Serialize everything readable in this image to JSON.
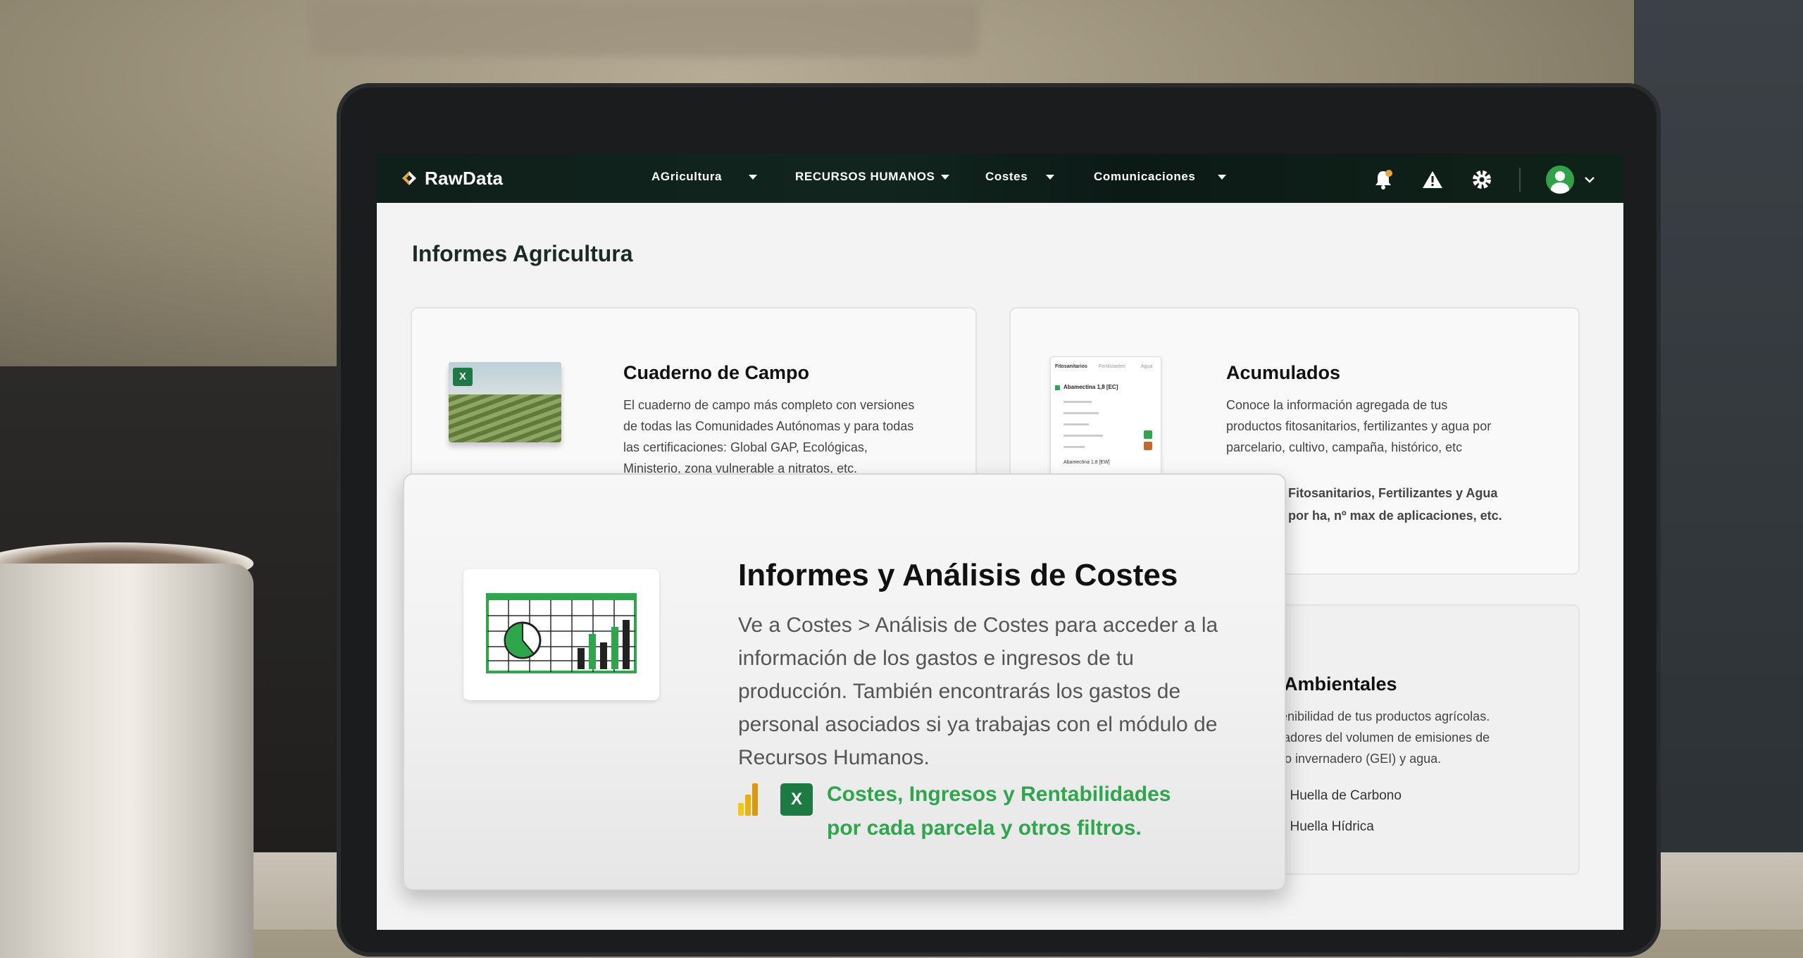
{
  "nav": {
    "brand": "RawData",
    "menus": [
      {
        "label": "AGricultura"
      },
      {
        "label": "RECURSOS HUMANOS"
      },
      {
        "label": "Costes"
      },
      {
        "label": "Comunicaciones"
      }
    ],
    "icons": [
      "bell-icon",
      "warning-icon",
      "gear-icon",
      "user-avatar",
      "chevron-down-icon"
    ],
    "accent": "#2ea64b"
  },
  "page": {
    "title": "Informes Agricultura"
  },
  "cards": {
    "cuaderno": {
      "title": "Cuaderno de Campo",
      "desc": [
        "El cuaderno de campo más completo con versiones",
        "de todas las Comunidades Autónomas y para todas",
        "las certificaciones: Global GAP, Ecológicas,",
        "Ministerio, zona vulnerable a nitratos, etc."
      ]
    },
    "acumulados": {
      "title": "Acumulados",
      "desc": [
        "Conoce la información agregada de tus",
        "productos fitosanitarios, fertilizantes y agua por",
        "parcelario, cultivo, campaña, histórico, etc"
      ],
      "links": [
        "de Fitosanitarios, Fertilizantes y Agua",
        "os por ha, nº max de aplicaciones, etc."
      ],
      "mini_doc": {
        "tab": "Fitosanitarios",
        "tab2": "Fertilizantes",
        "tab3": "Agua",
        "item": "Abamectina 1,8 [EC]",
        "item2": "Abamectina 1,8 [EW]"
      }
    },
    "ambientales": {
      "title": "os Ambientales",
      "desc": [
        "sostenibilidad de tus productos agrícolas.",
        "indicadores del volumen de emisiones de",
        "efecto invernadero (GEI) y agua."
      ],
      "links": [
        "lo de Huella de Carbono",
        "lo de Huella Hídrica"
      ]
    }
  },
  "overlay": {
    "title": "Informes y Análisis de Costes",
    "text": "Ve a Costes > Análisis de Costes para acceder a la información de los gastos e ingresos de tu producción. También encontrarás los gastos de personal asociados si ya trabajas con el módulo de Recursos Humanos.",
    "link_line1": "Costes, Ingresos y Rentabilidades",
    "link_line2": "por cada parcela y otros filtros."
  }
}
